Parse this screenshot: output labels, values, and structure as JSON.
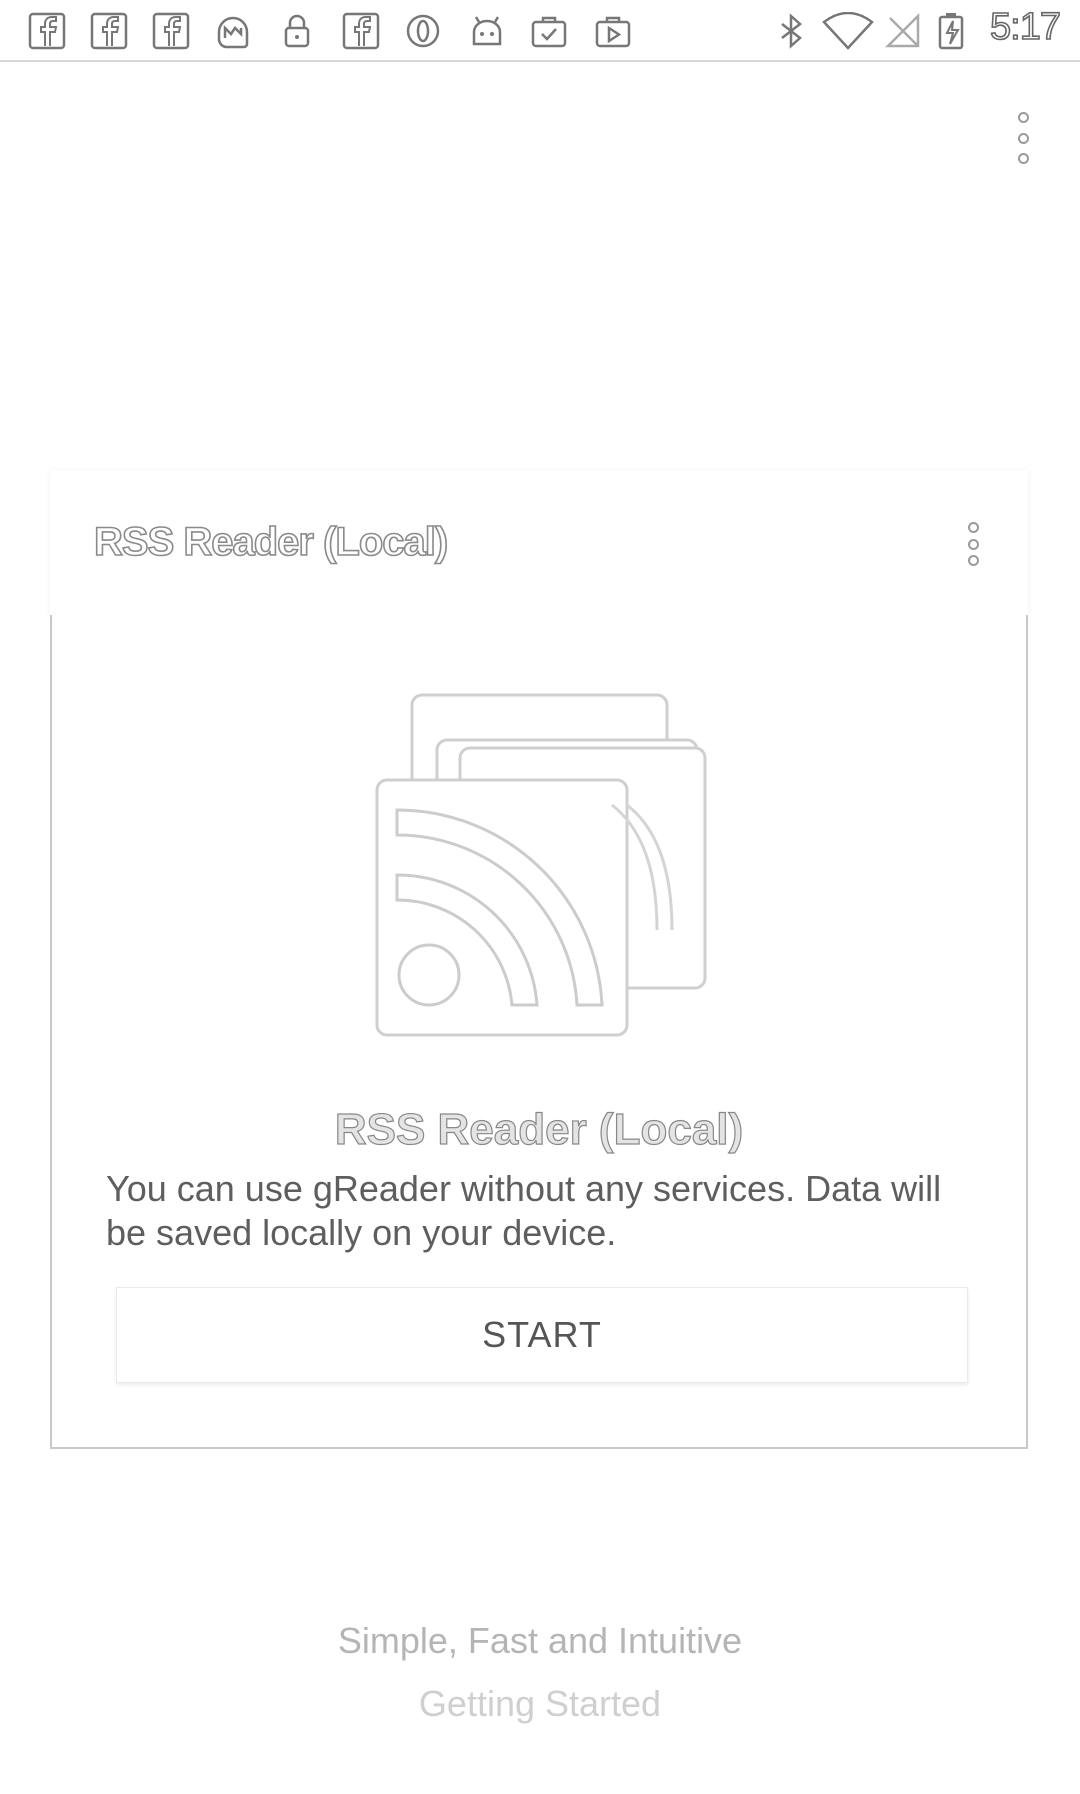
{
  "status_bar": {
    "time": "5:17",
    "notification_icons": [
      "facebook-icon",
      "facebook-icon",
      "facebook-icon",
      "messenger-icon",
      "lock-icon",
      "facebook-icon",
      "opera-icon",
      "android-icon",
      "briefcase-check-icon",
      "play-store-icon"
    ],
    "system_icons": [
      "bluetooth-icon",
      "wifi-icon",
      "no-signal-icon",
      "battery-charging-icon"
    ]
  },
  "card": {
    "header_title": "RSS Reader (Local)",
    "body_title": "RSS Reader (Local)",
    "description": "You can use gReader without any services. Data will be saved locally on your device.",
    "start_label": "START",
    "illustration_icon": "rss-feed-icon"
  },
  "footer": {
    "tagline": "Simple, Fast and Intuitive",
    "getting_started": "Getting Started"
  }
}
